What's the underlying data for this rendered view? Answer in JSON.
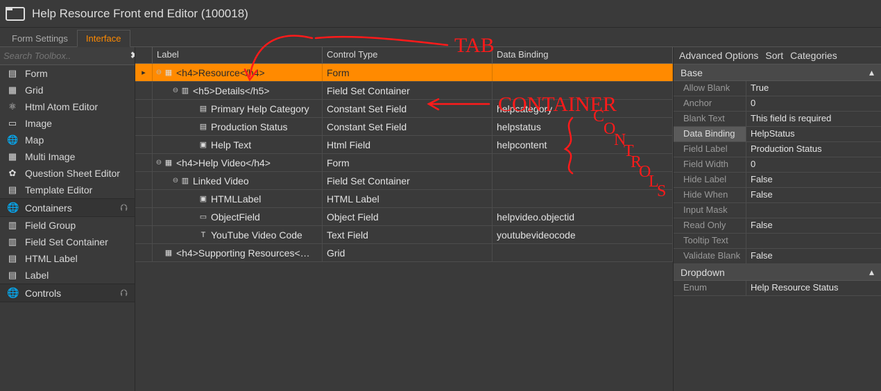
{
  "title": "Help Resource Front end Editor (100018)",
  "tabs": [
    {
      "label": "Form Settings",
      "active": false
    },
    {
      "label": "Interface",
      "active": true
    }
  ],
  "search_placeholder": "Search Toolbox..",
  "toolbox_basic": [
    {
      "icon": "▤",
      "label": "Form"
    },
    {
      "icon": "▦",
      "label": "Grid"
    },
    {
      "icon": "⚛",
      "label": "Html Atom Editor"
    },
    {
      "icon": "▭",
      "label": "Image"
    },
    {
      "icon": "🌐",
      "label": "Map"
    },
    {
      "icon": "▦",
      "label": "Multi Image"
    },
    {
      "icon": "✿",
      "label": "Question Sheet Editor"
    },
    {
      "icon": "▤",
      "label": "Template Editor"
    }
  ],
  "sections": [
    {
      "icon": "🌐",
      "label": "Containers"
    },
    {
      "icon": "🌐",
      "label": "Controls"
    }
  ],
  "container_tools": [
    {
      "icon": "▥",
      "label": "Field Group"
    },
    {
      "icon": "▥",
      "label": "Field Set Container"
    },
    {
      "icon": "▤",
      "label": "HTML Label"
    },
    {
      "icon": "▤",
      "label": "Label"
    }
  ],
  "grid_columns": {
    "c0": "Label",
    "c1": "Control Type",
    "c2": "Data Binding"
  },
  "rows": [
    {
      "gutter": "▸",
      "indent": 1,
      "toggle": "⊖",
      "icon": "▦",
      "label": "<h4>Resource</h4>",
      "type": "Form",
      "bind": "",
      "selected": true
    },
    {
      "gutter": "",
      "indent": 2,
      "toggle": "⊖",
      "icon": "▥",
      "label": "<h5>Details</h5>",
      "type": "Field Set Container",
      "bind": ""
    },
    {
      "gutter": "",
      "indent": 3,
      "toggle": "",
      "icon": "▤",
      "label": "Primary Help Category",
      "type": "Constant Set Field",
      "bind": "helpcategory"
    },
    {
      "gutter": "",
      "indent": 3,
      "toggle": "",
      "icon": "▤",
      "label": "Production Status",
      "type": "Constant Set Field",
      "bind": "helpstatus"
    },
    {
      "gutter": "",
      "indent": 3,
      "toggle": "",
      "icon": "▣",
      "label": "Help Text",
      "type": "Html Field",
      "bind": "helpcontent"
    },
    {
      "gutter": "",
      "indent": 1,
      "toggle": "⊖",
      "icon": "▦",
      "label": "<h4>Help Video</h4>",
      "type": "Form",
      "bind": ""
    },
    {
      "gutter": "",
      "indent": 2,
      "toggle": "⊖",
      "icon": "▥",
      "label": "Linked Video",
      "type": "Field Set Container",
      "bind": ""
    },
    {
      "gutter": "",
      "indent": 3,
      "toggle": "",
      "icon": "▣",
      "label": "HTMLLabel",
      "type": "HTML Label",
      "bind": ""
    },
    {
      "gutter": "",
      "indent": 3,
      "toggle": "",
      "icon": "▭",
      "label": "ObjectField",
      "type": "Object Field",
      "bind": "helpvideo.objectid"
    },
    {
      "gutter": "",
      "indent": 3,
      "toggle": "",
      "icon": "T",
      "label": "YouTube Video Code",
      "type": "Text Field",
      "bind": "youtubevideocode"
    },
    {
      "gutter": "",
      "indent": 1,
      "toggle": "",
      "icon": "▦",
      "label": "<h4>Supporting Resources<…",
      "type": "Grid",
      "bind": ""
    }
  ],
  "prop_tabs": {
    "t0": "Advanced Options",
    "t1": "Sort",
    "t2": "Categories"
  },
  "prop_groups": {
    "g0": "Base",
    "g1": "Dropdown"
  },
  "props_base": [
    {
      "name": "Allow Blank",
      "value": "True"
    },
    {
      "name": "Anchor",
      "value": "0"
    },
    {
      "name": "Blank Text",
      "value": "This field is required"
    },
    {
      "name": "Data Binding",
      "value": "HelpStatus",
      "highlight": true
    },
    {
      "name": "Field Label",
      "value": "Production Status"
    },
    {
      "name": "Field Width",
      "value": "0"
    },
    {
      "name": "Hide Label",
      "value": "False"
    },
    {
      "name": "Hide When",
      "value": "False"
    },
    {
      "name": "Input Mask",
      "value": ""
    },
    {
      "name": "Read Only",
      "value": "False"
    },
    {
      "name": "Tooltip Text",
      "value": ""
    },
    {
      "name": "Validate Blank",
      "value": "False"
    }
  ],
  "props_dropdown": [
    {
      "name": "Enum",
      "value": "Help Resource Status"
    }
  ],
  "annotations": {
    "tab": "TAB",
    "container": "CONTAINER",
    "controls": "CONTROLS"
  }
}
